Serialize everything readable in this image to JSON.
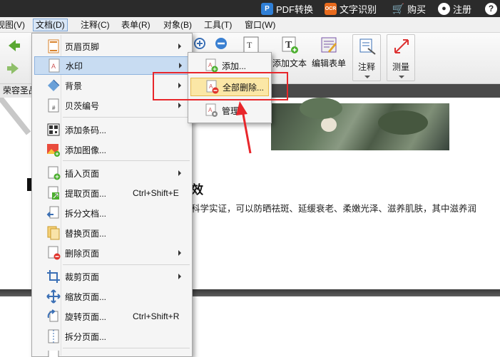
{
  "titlebar": {
    "pdf_convert": "PDF转换",
    "ocr_badge": "OCR",
    "ocr": "文字识别",
    "buy": "购买",
    "register": "注册",
    "help": "?"
  },
  "menubar": {
    "items": [
      {
        "label": "视图(V)"
      },
      {
        "label": "文档(D)"
      },
      {
        "label": "注释(C)"
      },
      {
        "label": "表单(R)"
      },
      {
        "label": "对象(B)"
      },
      {
        "label": "工具(T)"
      },
      {
        "label": "窗口(W)"
      }
    ]
  },
  "toolbar": {
    "add_text": "添加文本",
    "edit_form": "编辑表单",
    "annotate": "注释",
    "measure": "测量"
  },
  "tab": {
    "label": "荣容圣品-"
  },
  "document": {
    "heading_fragment": "效",
    "body_text": "科学实证，可以防晒祛斑、延缓衰老、柔嫩光泽、滋养肌肤，其中滋养润"
  },
  "dropdown": {
    "items": [
      {
        "label": "页眉页脚",
        "submenu": true
      },
      {
        "label": "水印",
        "submenu": true,
        "highlight": true
      },
      {
        "label": "背景",
        "submenu": true
      },
      {
        "label": "贝茨编号",
        "submenu": true
      },
      {
        "label": "添加条码..."
      },
      {
        "label": "添加图像..."
      },
      {
        "label": "插入页面",
        "submenu": true
      },
      {
        "label": "提取页面...",
        "shortcut": "Ctrl+Shift+E"
      },
      {
        "label": "拆分文档..."
      },
      {
        "label": "替换页面..."
      },
      {
        "label": "删除页面",
        "submenu": true
      },
      {
        "label": "裁剪页面",
        "submenu": true
      },
      {
        "label": "缩放页面..."
      },
      {
        "label": "旋转页面...",
        "shortcut": "Ctrl+Shift+R"
      },
      {
        "label": "拆分页面..."
      }
    ]
  },
  "submenu": {
    "items": [
      {
        "label": "添加..."
      },
      {
        "label": "全部删除...",
        "highlight": true
      },
      {
        "label": "管理..."
      }
    ]
  },
  "colors": {
    "annotation_red": "#e8262b",
    "highlight_blue": "#c8dcf2",
    "highlight_yellow": "#fbe7a6"
  }
}
